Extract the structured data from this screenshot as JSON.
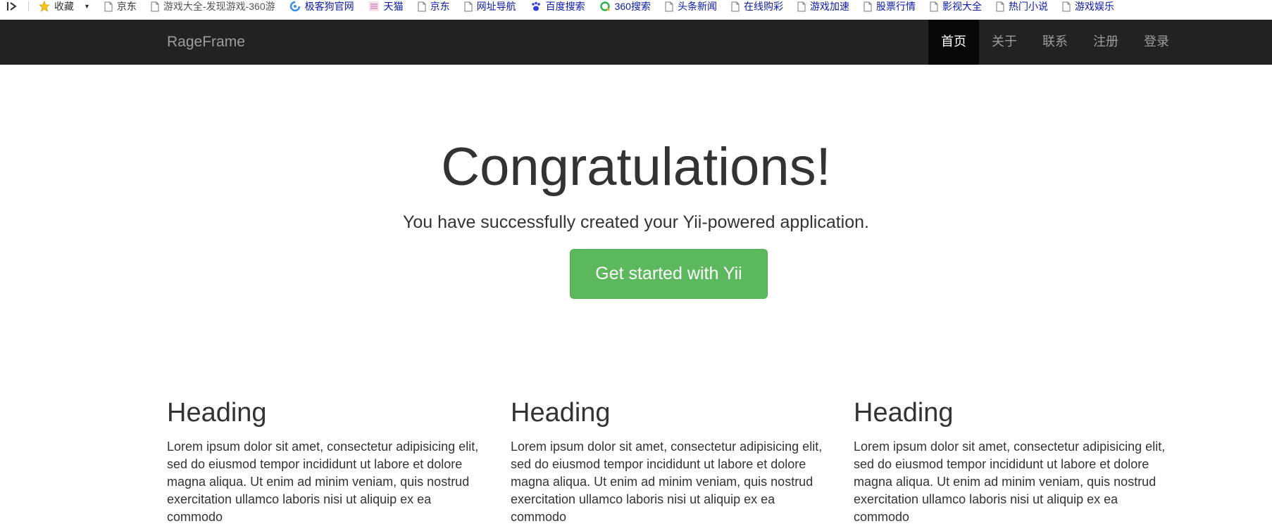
{
  "bookmarks": {
    "favorites_label": "收藏",
    "items": [
      {
        "label": "京东",
        "style": "normal",
        "icon": "page-icon"
      },
      {
        "label": "游戏大全-发现游戏-360游",
        "style": "faded",
        "icon": "page-icon"
      },
      {
        "label": "极客狗官网",
        "style": "link",
        "icon": "swirl-icon"
      },
      {
        "label": "天猫",
        "style": "link",
        "icon": "tmall-icon"
      },
      {
        "label": "京东",
        "style": "link",
        "icon": "page-icon"
      },
      {
        "label": "网址导航",
        "style": "link",
        "icon": "page-icon"
      },
      {
        "label": "百度搜索",
        "style": "link",
        "icon": "baidu-paw-icon"
      },
      {
        "label": "360搜索",
        "style": "link",
        "icon": "360-icon"
      },
      {
        "label": "头条新闻",
        "style": "link",
        "icon": "page-icon"
      },
      {
        "label": "在线购彩",
        "style": "link",
        "icon": "page-icon"
      },
      {
        "label": "游戏加速",
        "style": "link",
        "icon": "page-icon"
      },
      {
        "label": "股票行情",
        "style": "link",
        "icon": "page-icon"
      },
      {
        "label": "影视大全",
        "style": "link",
        "icon": "page-icon"
      },
      {
        "label": "热门小说",
        "style": "link",
        "icon": "page-icon"
      },
      {
        "label": "游戏娱乐",
        "style": "link",
        "icon": "page-icon"
      }
    ]
  },
  "navbar": {
    "brand": "RageFrame",
    "links": [
      {
        "label": "首页",
        "active": true
      },
      {
        "label": "关于",
        "active": false
      },
      {
        "label": "联系",
        "active": false
      },
      {
        "label": "注册",
        "active": false
      },
      {
        "label": "登录",
        "active": false
      }
    ]
  },
  "jumbotron": {
    "title": "Congratulations!",
    "lead": "You have successfully created your Yii-powered application.",
    "button_label": "Get started with Yii"
  },
  "columns": [
    {
      "heading": "Heading",
      "body": "Lorem ipsum dolor sit amet, consectetur adipisicing elit, sed do eiusmod tempor incididunt ut labore et dolore magna aliqua. Ut enim ad minim veniam, quis nostrud exercitation ullamco laboris nisi ut aliquip ex ea commodo"
    },
    {
      "heading": "Heading",
      "body": "Lorem ipsum dolor sit amet, consectetur adipisicing elit, sed do eiusmod tempor incididunt ut labore et dolore magna aliqua. Ut enim ad minim veniam, quis nostrud exercitation ullamco laboris nisi ut aliquip ex ea commodo"
    },
    {
      "heading": "Heading",
      "body": "Lorem ipsum dolor sit amet, consectetur adipisicing elit, sed do eiusmod tempor incididunt ut labore et dolore magna aliqua. Ut enim ad minim veniam, quis nostrud exercitation ullamco laboris nisi ut aliquip ex ea commodo"
    }
  ],
  "colors": {
    "navbar_bg": "#222222",
    "navbar_active_bg": "#080808",
    "button_green": "#5cb85c",
    "bookmark_link": "#0b1aa8"
  }
}
